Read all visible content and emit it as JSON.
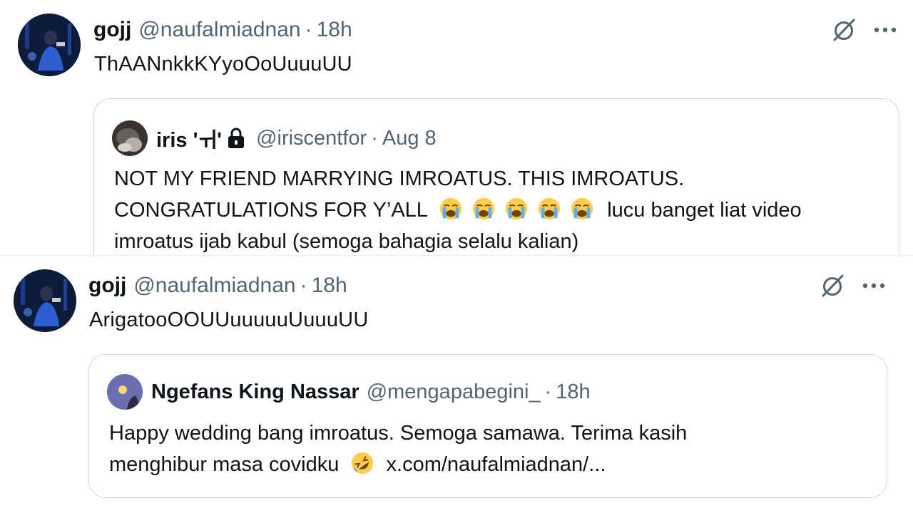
{
  "tweet_top": {
    "author_name": "gojj",
    "author_handle": "@naufalmiadnan",
    "separator": "·",
    "time": "18h",
    "text": "ThAANnkkKYyoOoUuuuUU",
    "quote": {
      "author_name": "iris 'ㅟ'",
      "author_handle": "@iriscentfor",
      "separator": "·",
      "time": "Aug 8",
      "line1": "NOT MY FRIEND MARRYING IMROATUS. THIS IMROATUS.",
      "line2_prefix": "CONGRATULATIONS FOR Y’ALL",
      "line2_suffix": "lucu banget liat video",
      "line3": "imroatus ijab kabul (semoga bahagia selalu kalian)",
      "emoji_name": "loudly-crying-face",
      "emoji_count": 5
    }
  },
  "tweet_bottom": {
    "author_name": "gojj",
    "author_handle": "@naufalmiadnan",
    "separator": "·",
    "time": "18h",
    "text": "ArigatooOOUUuuuuuUuuuUU",
    "quote": {
      "author_name": "Ngefans King Nassar",
      "author_handle": "@mengapabegini_",
      "separator": "·",
      "time": "18h",
      "line1": "Happy wedding bang imroatus. Semoga samawa. Terima kasih",
      "line2_prefix": "menghibur masa covidku",
      "line2_suffix": "x.com/naufalmiadnan/...",
      "emoji_name": "rolling-on-the-floor-laughing"
    }
  },
  "icons": {
    "grok": "grok-icon",
    "more": "more-icon",
    "lock": "lock-icon"
  },
  "colors": {
    "text": "#0f1419",
    "secondary": "#536471",
    "border": "#cfd9de"
  }
}
